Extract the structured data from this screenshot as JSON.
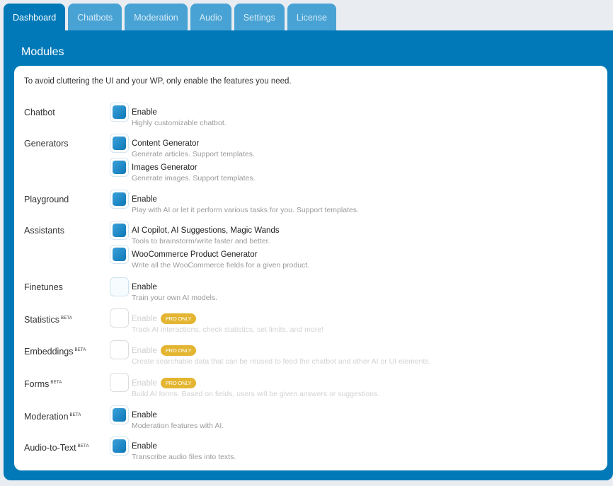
{
  "tabs": [
    {
      "label": "Dashboard",
      "active": true
    },
    {
      "label": "Chatbots",
      "active": false
    },
    {
      "label": "Moderation",
      "active": false
    },
    {
      "label": "Audio",
      "active": false
    },
    {
      "label": "Settings",
      "active": false
    },
    {
      "label": "License",
      "active": false
    }
  ],
  "panel": {
    "title": "Modules",
    "intro": "To avoid cluttering the UI and your WP, only enable the features you need."
  },
  "beta_label": "BETA",
  "pro_label": "PRO ONLY",
  "modules": [
    {
      "label": "Chatbot",
      "beta": false,
      "options": [
        {
          "title": "Enable",
          "desc": "Highly customizable chatbot.",
          "state": "checked"
        }
      ]
    },
    {
      "label": "Generators",
      "beta": false,
      "options": [
        {
          "title": "Content Generator",
          "desc": "Generate articles. Support templates.",
          "state": "checked"
        },
        {
          "title": "Images Generator",
          "desc": "Generate images. Support templates.",
          "state": "checked"
        }
      ]
    },
    {
      "label": "Playground",
      "beta": false,
      "options": [
        {
          "title": "Enable",
          "desc": "Play with AI or let it perform various tasks for you. Support templates.",
          "state": "checked"
        }
      ]
    },
    {
      "label": "Assistants",
      "beta": false,
      "options": [
        {
          "title": "AI Copilot, AI Suggestions, Magic Wands",
          "desc": "Tools to brainstorm/write faster and better.",
          "state": "checked"
        },
        {
          "title": "WooCommerce Product Generator",
          "desc": "Write all the WooCommerce fields for a given product.",
          "state": "checked"
        }
      ]
    },
    {
      "label": "Finetunes",
      "beta": false,
      "options": [
        {
          "title": "Enable",
          "desc": "Train your own AI models.",
          "state": "unchecked"
        }
      ]
    },
    {
      "label": "Statistics",
      "beta": true,
      "options": [
        {
          "title": "Enable",
          "desc": "Track AI interactions, check statistics, set limits, and more!",
          "state": "disabled",
          "pro": true
        }
      ]
    },
    {
      "label": "Embeddings",
      "beta": true,
      "options": [
        {
          "title": "Enable",
          "desc": "Create searchable data that can be reused to feed the chatbot and other AI or UI elements.",
          "state": "disabled",
          "pro": true
        }
      ]
    },
    {
      "label": "Forms",
      "beta": true,
      "options": [
        {
          "title": "Enable",
          "desc": "Build AI forms. Based on fields, users will be given answers or suggestions.",
          "state": "disabled",
          "pro": true
        }
      ]
    },
    {
      "label": "Moderation",
      "beta": true,
      "options": [
        {
          "title": "Enable",
          "desc": "Moderation features with AI.",
          "state": "checked"
        }
      ]
    },
    {
      "label": "Audio-to-Text",
      "beta": true,
      "options": [
        {
          "title": "Enable",
          "desc": "Transcribe audio files into texts.",
          "state": "checked"
        }
      ]
    }
  ],
  "colors": {
    "primary": "#0179b8",
    "tab_inactive": "#48a2d4",
    "pro_badge": "#e3b530",
    "background": "#e9edf1"
  }
}
